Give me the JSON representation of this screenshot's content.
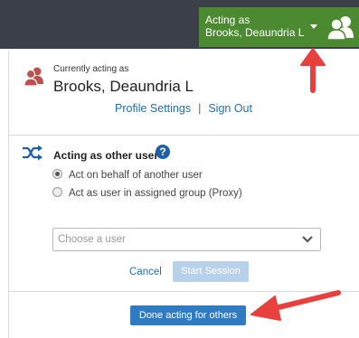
{
  "header": {
    "acting_label": "Acting as",
    "acting_name": "Brooks, Deaundria L",
    "icons": {
      "caret": "caret-down-icon",
      "avatar": "users-icon"
    }
  },
  "panel": {
    "currently_label": "Currently acting as",
    "user_name": "Brooks, Deaundria L",
    "profile_settings": "Profile Settings",
    "separator": "|",
    "sign_out": "Sign Out"
  },
  "acting_other": {
    "title": "Acting as other user",
    "help_glyph": "?",
    "options": [
      {
        "label": "Act on behalf of another user",
        "selected": true
      },
      {
        "label": "Act as user in assigned group (Proxy)",
        "selected": false
      }
    ],
    "select_placeholder": "Choose a user",
    "cancel": "Cancel",
    "start_session": "Start Session"
  },
  "done_button": "Done acting for others",
  "colors": {
    "topbar": "#3c4048",
    "acting_green": "#4c8a31",
    "link_blue": "#1f6fb2",
    "primary_blue": "#2f7bc1",
    "disabled_blue": "#b8d1ea",
    "annotation_red": "#e8403c",
    "user_icon_red": "#c0504d"
  }
}
